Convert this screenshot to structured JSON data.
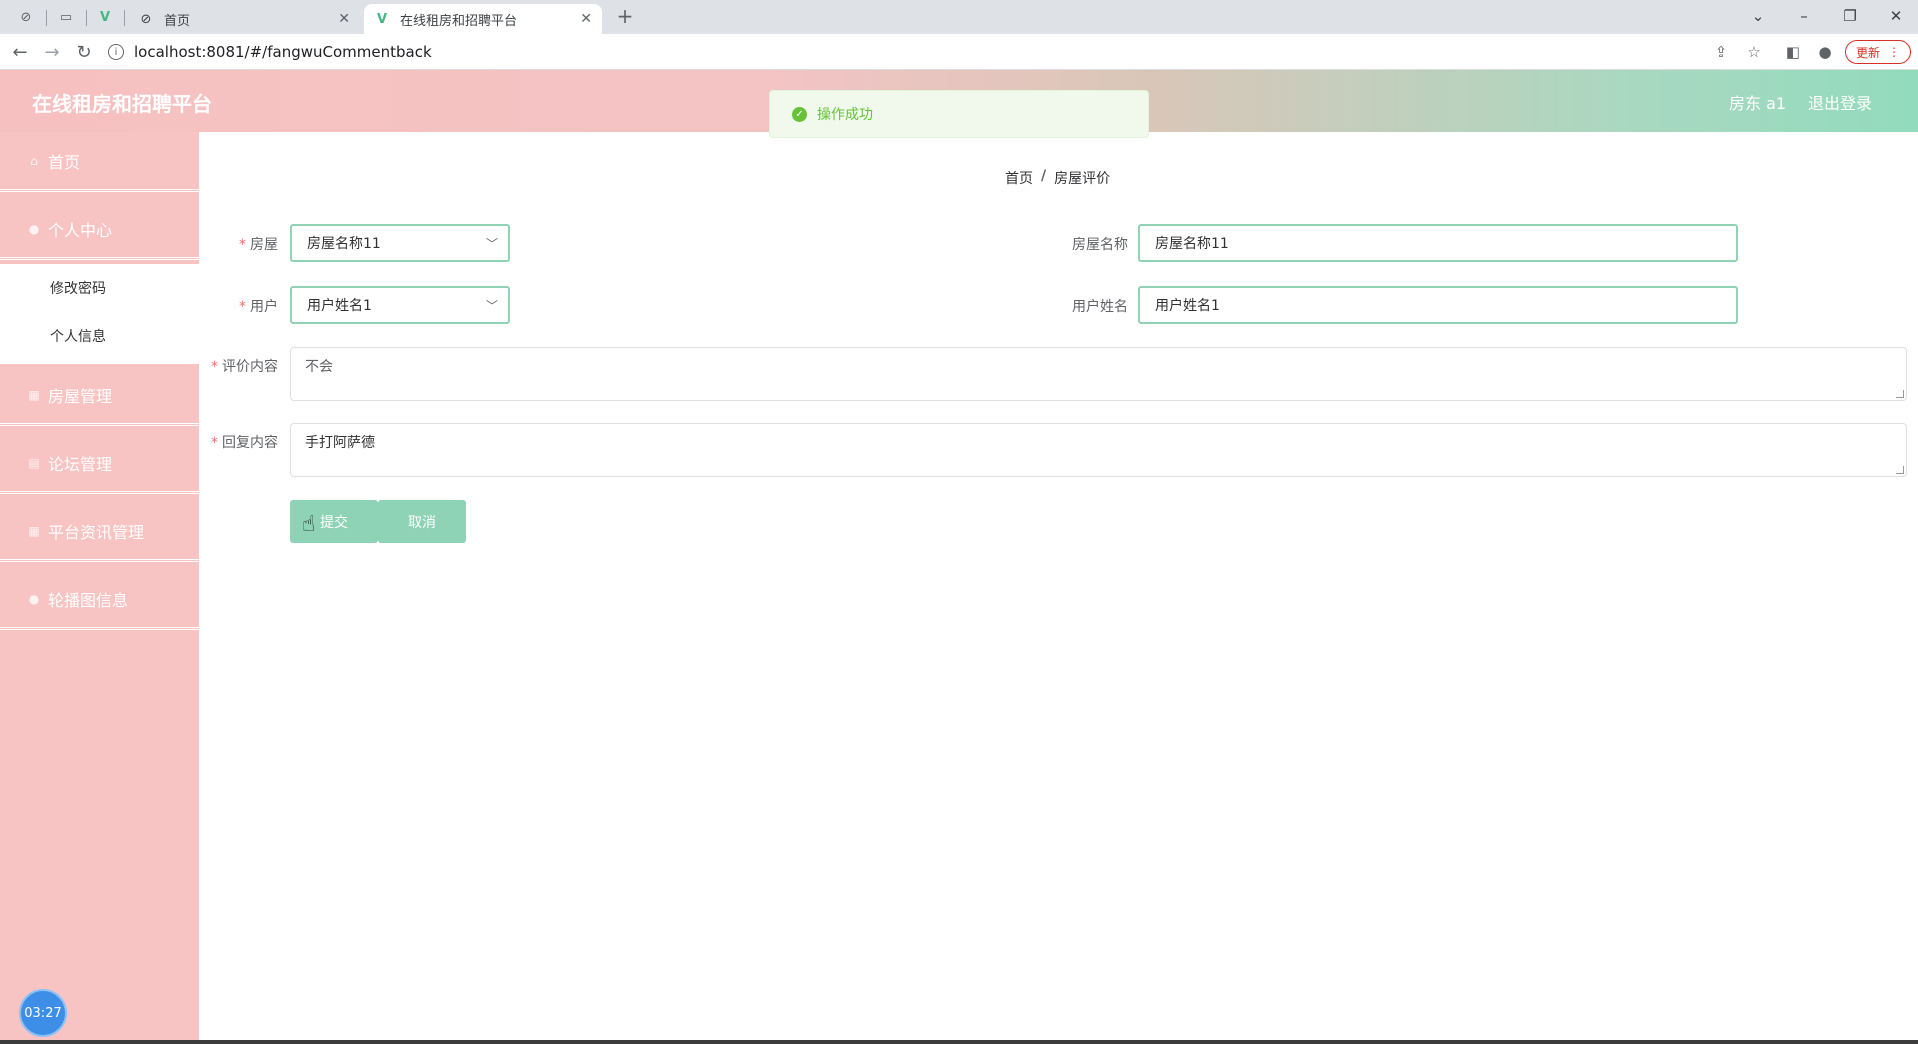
{
  "browser": {
    "tabs": [
      {
        "title": "首页"
      },
      {
        "title": "在线租房和招聘平台"
      }
    ],
    "url": "localhost:8081/#/fangwuCommentback",
    "update_label": "更新"
  },
  "header": {
    "app_title": "在线租房和招聘平台",
    "user": "房东 a1",
    "logout": "退出登录"
  },
  "toast": {
    "message": "操作成功"
  },
  "sidebar": {
    "items": [
      {
        "label": "首页",
        "icon": "home-icon"
      },
      {
        "label": "个人中心",
        "icon": "user-icon"
      },
      {
        "label": "房屋管理",
        "icon": "grid-icon"
      },
      {
        "label": "论坛管理",
        "icon": "chat-icon"
      },
      {
        "label": "平台资讯管理",
        "icon": "grid-icon"
      },
      {
        "label": "轮播图信息",
        "icon": "user-icon"
      }
    ],
    "submenu": [
      "修改密码",
      "个人信息"
    ],
    "timer": "03:27"
  },
  "breadcrumb": {
    "home": "首页",
    "current": "房屋评价"
  },
  "form": {
    "house_label": "房屋",
    "house_value": "房屋名称11",
    "house_name_label": "房屋名称",
    "house_name_value": "房屋名称11",
    "user_label": "用户",
    "user_value": "用户姓名1",
    "user_name_label": "用户姓名",
    "user_name_value": "用户姓名1",
    "comment_label": "评价内容",
    "comment_value": "不会",
    "reply_label": "回复内容",
    "reply_value": "手打阿萨德",
    "submit": "提交",
    "cancel": "取消"
  },
  "colors": {
    "accent": "#8fd3b6",
    "sidebar": "#f8c3c3",
    "success": "#67c23a"
  }
}
